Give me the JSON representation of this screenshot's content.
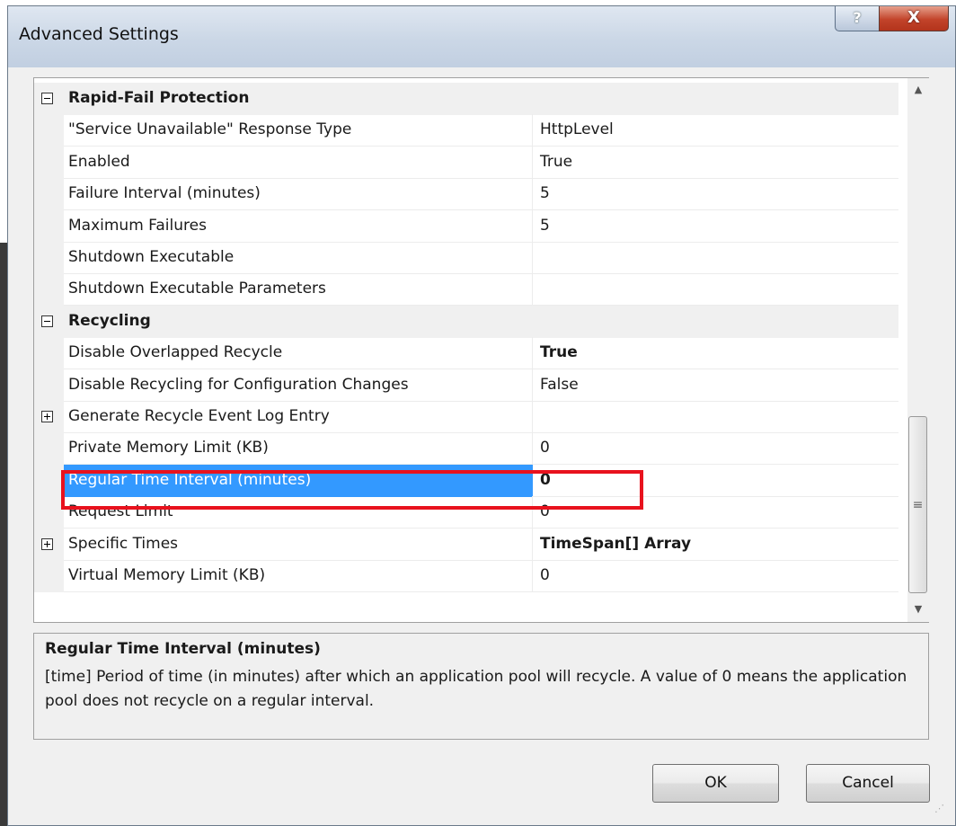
{
  "window": {
    "title": "Advanced Settings",
    "help_label": "?",
    "close_label": "X"
  },
  "grid": {
    "rows": [
      {
        "type": "category",
        "expander": "minus",
        "name": "Rapid-Fail Protection",
        "value": ""
      },
      {
        "type": "property",
        "name": "\"Service Unavailable\" Response Type",
        "value": "HttpLevel"
      },
      {
        "type": "property",
        "name": "Enabled",
        "value": "True"
      },
      {
        "type": "property",
        "name": "Failure Interval (minutes)",
        "value": "5"
      },
      {
        "type": "property",
        "name": "Maximum Failures",
        "value": "5"
      },
      {
        "type": "property",
        "name": "Shutdown Executable",
        "value": ""
      },
      {
        "type": "property",
        "name": "Shutdown Executable Parameters",
        "value": ""
      },
      {
        "type": "category",
        "expander": "minus",
        "name": "Recycling",
        "value": ""
      },
      {
        "type": "property",
        "name": "Disable Overlapped Recycle",
        "value": "True",
        "value_bold": true
      },
      {
        "type": "property",
        "name": "Disable Recycling for Configuration Changes",
        "value": "False"
      },
      {
        "type": "property",
        "expander": "plus",
        "name": "Generate Recycle Event Log Entry",
        "value": ""
      },
      {
        "type": "property",
        "name": "Private Memory Limit (KB)",
        "value": "0"
      },
      {
        "type": "property",
        "name": "Regular Time Interval (minutes)",
        "value": "0",
        "value_bold": true,
        "selected": true
      },
      {
        "type": "property",
        "name": "Request Limit",
        "value": "0"
      },
      {
        "type": "property",
        "expander": "plus",
        "name": "Specific Times",
        "value": "TimeSpan[] Array",
        "value_bold": true
      },
      {
        "type": "property",
        "name": "Virtual Memory Limit (KB)",
        "value": "0"
      }
    ]
  },
  "scrollbar": {
    "up_glyph": "▲",
    "down_glyph": "▼",
    "thumb_glyph": "≡"
  },
  "description": {
    "title": "Regular Time Interval (minutes)",
    "text": "[time] Period of time (in minutes) after which an application pool will recycle.  A value of 0 means the application pool does not recycle on a regular interval."
  },
  "buttons": {
    "ok": "OK",
    "cancel": "Cancel"
  },
  "colors": {
    "selection": "#3399ff",
    "highlight_box": "#e8121e",
    "close_button": "#c2432a"
  }
}
